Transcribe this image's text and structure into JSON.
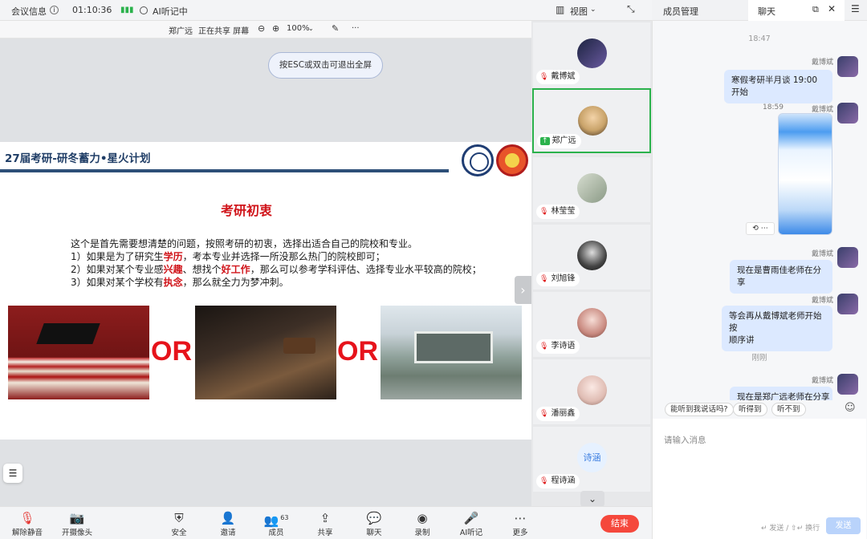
{
  "topbar": {
    "meeting_info": "会议信息",
    "timer": "01:10:36",
    "ai_notes": "AI听记中",
    "view": "视图"
  },
  "sharebar": {
    "presenter": "郑广远",
    "sharing": "正在共享 屏幕",
    "zoom": "100%"
  },
  "esc_hint": "按ESC或双击可退出全屏",
  "slide": {
    "title": "27届考研-研冬蓄力•星火计划",
    "heading": "考研初衷",
    "intro": "这个是首先需要想清楚的问题，按照考研的初衷，选择出适合自己的院校和专业。",
    "l1a": "1）如果是为了研究生",
    "l1b": "学历",
    "l1c": "，考本专业并选择一所没那么热门的院校即可；",
    "l2a": "2）如果对某个专业感",
    "l2b": "兴趣",
    "l2c": "、想找个",
    "l2d": "好工作",
    "l2e": "，那么可以参考学科评估、选择专业水平较高的院校；",
    "l3a": "3）如果对某个学校有",
    "l3b": "执念",
    "l3c": "，那么就全力为梦冲刺。",
    "or1": "OR",
    "or2": "OR"
  },
  "participants": [
    {
      "name": "戴博斌",
      "status": "muted",
      "avatar_color": "#2f3a5e"
    },
    {
      "name": "郑广远",
      "status": "sharing",
      "avatar_color": "#c9a36a"
    },
    {
      "name": "林莹莹",
      "status": "muted",
      "avatar_color": "#aab7a2"
    },
    {
      "name": "刘旭锋",
      "status": "muted",
      "avatar_color": "#2a2a2a"
    },
    {
      "name": "李诗语",
      "status": "muted",
      "avatar_color": "#d9a19a"
    },
    {
      "name": "潘丽鑫",
      "status": "muted",
      "avatar_color": "#e7c9c2"
    },
    {
      "name": "程诗涵",
      "status": "muted",
      "avatar_text": "诗涵",
      "avatar_color": "#e6f1ff"
    }
  ],
  "toolbar": {
    "mute": "解除静音",
    "camera": "开摄像头",
    "security": "安全",
    "invite": "邀请",
    "members": "成员",
    "members_count": "63",
    "share": "共享",
    "chat": "聊天",
    "record": "录制",
    "ai": "AI听记",
    "more": "更多",
    "end": "结束"
  },
  "panel": {
    "tab_members": "成员管理",
    "tab_chat": "聊天",
    "ts1": "18:47",
    "ts2": "18:59",
    "ts3": "刚刚",
    "m1_sender": "戴博斌",
    "m1": "寒假考研半月谈 19:00 开始",
    "m2_sender": "戴博斌",
    "m3_sender": "戴博斌",
    "m3": "现在是曹雨佳老师在分享",
    "m4_sender": "戴博斌",
    "m4a": "等会再从戴博斌老师开始按",
    "m4b": "顺序讲",
    "m5_sender": "戴博斌",
    "m5": "现在是郑广远老师在分享",
    "quick1": "能听到我说话吗?",
    "quick2": "听得到",
    "quick3": "听不到",
    "placeholder": "请输入消息",
    "hint": "↵ 发送 / ⇧↵ 换行",
    "send": "发送"
  }
}
